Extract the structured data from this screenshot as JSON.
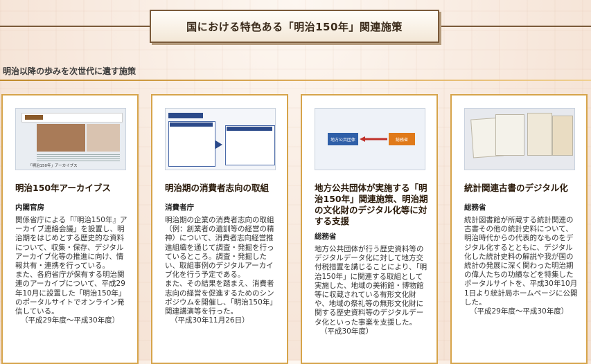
{
  "banner": {
    "title": "国における特色ある「明治150年」関連施策"
  },
  "section": {
    "heading": "明治以降の歩みを次世代に遺す施策"
  },
  "cards": [
    {
      "title": "明治150年アーカイブス",
      "agency": "内閣官房",
      "thumb_caption": "「明治150年」アーカイブス",
      "description": "関係省庁による「『明治150年』アーカイブ連絡会議」を設置し、明治期をはじめとする歴史的な資料について、収集・保存、デジタルアーカイブ化等の推進に向け、情報共有・連携を行っている。\nまた、各府省庁が保有する明治関連のアーカイブについて、平成29年10月に設置した「明治150年」のポータルサイトでオンライン発信している。",
      "period": "（平成29年度～平成30年度）"
    },
    {
      "title": "明治期の消費者志向の取組",
      "agency": "消費者庁",
      "description": "明治期の企業の消費者志向の取組（例：創業者の遺訓等の経営の精神）について、消費者志向経営推進組織を通じて調査・発掘を行っているところ。調査・発掘したい、取組事例のデジタルアーカイブ化を行う予定である。\nまた、その結果を踏まえ、消費者志向の経営を促進するためのシンポジウムを開催し、「明治150年」関連講演等を行った。",
      "period": "（平成30年11月26日）"
    },
    {
      "title": "地方公共団体が実施する「明治150年」関連施策、明治期の文化財のデジタル化等に対する支援",
      "agency": "総務省",
      "thumb_left": "地方公共団体",
      "thumb_right": "総務省",
      "description": "地方公共団体が行う歴史資料等のデジタルデータ化に対して地方交付税措置を講じることにより、「明治150年」に関連する取組として実施した、地域の美術館・博物館等に収蔵されている有形文化財や、地域の祭礼等の無形文化財に関する歴史資料等のデジタルデータ化といった事業を支援した。",
      "period": "（平成30年度）"
    },
    {
      "title": "統計関連古書のデジタル化",
      "agency": "総務省",
      "description": "統計図書館が所蔵する統計関連の古書その他の統計史料について、明治時代からの代表的なものをデジタル化するとともに、デジタル化した統計史料の解説や我が国の統計の発展に深く関わった明治期の偉人たちの功績などを特集したポータルサイトを、平成30年10月1日より統計局ホームページに公開した。",
      "period": "（平成29年度～平成30年度）"
    }
  ],
  "colors": {
    "card_border": "#d6a44a",
    "title_border": "#7a5a3a",
    "section_rule": "#c08a2a"
  }
}
